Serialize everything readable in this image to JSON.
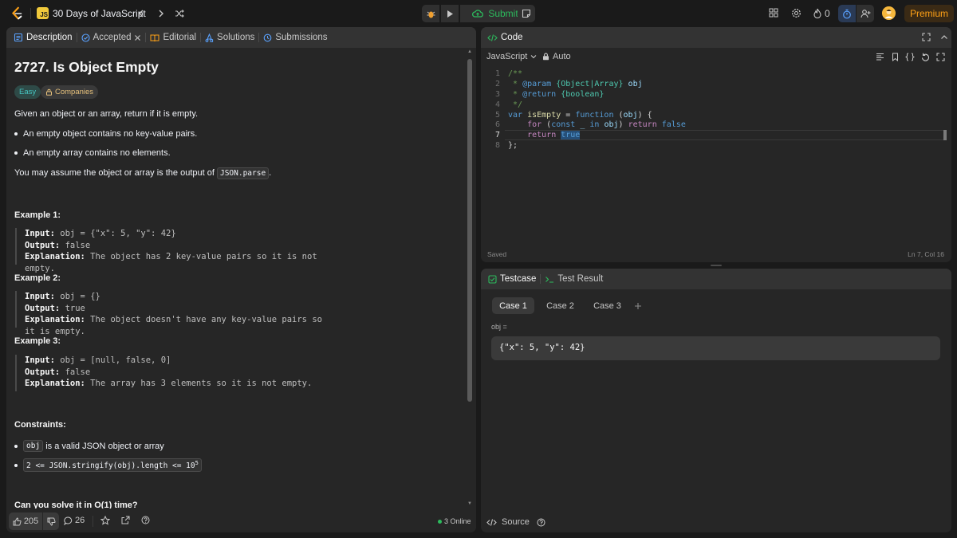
{
  "topbar": {
    "course_title": "30 Days of JavaScript",
    "js_badge": "JS",
    "submit_label": "Submit",
    "streak_count": "0",
    "premium_label": "Premium"
  },
  "left_panel": {
    "tabs": [
      {
        "label": "Description",
        "icon": "description-icon"
      },
      {
        "label": "Accepted",
        "icon": "accepted-icon"
      },
      {
        "label": "Editorial",
        "icon": "editorial-icon"
      },
      {
        "label": "Solutions",
        "icon": "solutions-icon"
      },
      {
        "label": "Submissions",
        "icon": "submissions-icon"
      }
    ],
    "title": "2727. Is Object Empty",
    "difficulty": "Easy",
    "companies": "Companies",
    "intro": "Given an object or an array, return if it is empty.",
    "bullets": [
      "An empty object contains no key-value pairs.",
      "An empty array contains no elements."
    ],
    "assume_prefix": "You may assume the object or array is the output of ",
    "assume_code": "JSON.parse",
    "assume_suffix": ".",
    "examples": [
      {
        "heading": "Example 1:",
        "input_label": "Input:",
        "input": " obj = {\"x\": 5, \"y\": 42}",
        "output_label": "Output:",
        "output": " false",
        "expl_label": "Explanation:",
        "expl": " The object has 2 key-value pairs so it is not empty."
      },
      {
        "heading": "Example 2:",
        "input_label": "Input:",
        "input": " obj = {}",
        "output_label": "Output:",
        "output": " true",
        "expl_label": "Explanation:",
        "expl": " The object doesn't have any key-value pairs so it is empty."
      },
      {
        "heading": "Example 3:",
        "input_label": "Input:",
        "input": " obj = [null, false, 0]",
        "output_label": "Output:",
        "output": " false",
        "expl_label": "Explanation:",
        "expl": " The array has 3 elements so it is not empty."
      }
    ],
    "constraints_heading": "Constraints:",
    "constraint_1_code": "obj",
    "constraint_1_text": " is a valid JSON object or array",
    "constraint_2_code": "2 <= JSON.stringify(obj).length <= 10",
    "constraint_2_sup": "5",
    "followup": "Can you solve it in O(1) time?",
    "likes": "205",
    "comments": "26",
    "online": "3 Online"
  },
  "code_panel": {
    "title": "Code",
    "language": "JavaScript",
    "mode": "Auto",
    "lines": [
      "/**",
      " * @param {Object|Array} obj",
      " * @return {boolean}",
      " */",
      "var isEmpty = function (obj) {",
      "    for (const _ in obj) return false",
      "    return true",
      "};"
    ],
    "saved": "Saved",
    "cursor": "Ln 7, Col 16"
  },
  "test_panel": {
    "tab_testcase": "Testcase",
    "tab_result": "Test Result",
    "cases": [
      "Case 1",
      "Case 2",
      "Case 3"
    ],
    "param_label": "obj =",
    "param_value": "{\"x\": 5, \"y\": 42}",
    "source_label": "Source"
  },
  "colors": {
    "accent_orange": "#ffa116",
    "submit_green": "#2cbb5d",
    "easy_teal": "#46c6c2"
  }
}
